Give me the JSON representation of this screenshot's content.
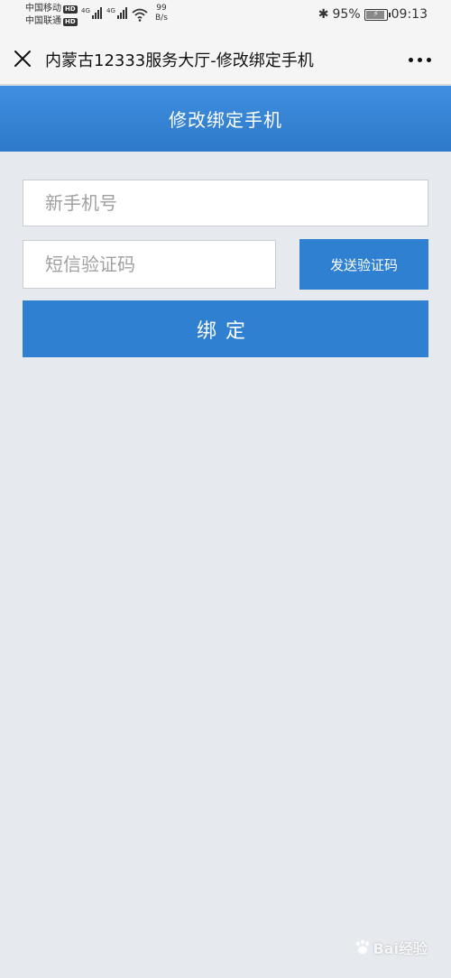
{
  "status_bar": {
    "carrier1": "中国移动",
    "carrier2": "中国联通",
    "hd": "HD",
    "net1": "4G",
    "net2": "4G",
    "speed_value": "99",
    "speed_unit": "B/s",
    "battery": "95%",
    "time": "09:13"
  },
  "nav": {
    "title": "内蒙古12333服务大厅-修改绑定手机"
  },
  "header": {
    "title": "修改绑定手机"
  },
  "form": {
    "phone_placeholder": "新手机号",
    "code_placeholder": "短信验证码",
    "send_code_label": "发送验证码",
    "bind_label": "绑定"
  },
  "watermark": {
    "text": "Bai经验"
  },
  "colors": {
    "primary": "#2f80d1",
    "background": "#e6e9ee"
  }
}
